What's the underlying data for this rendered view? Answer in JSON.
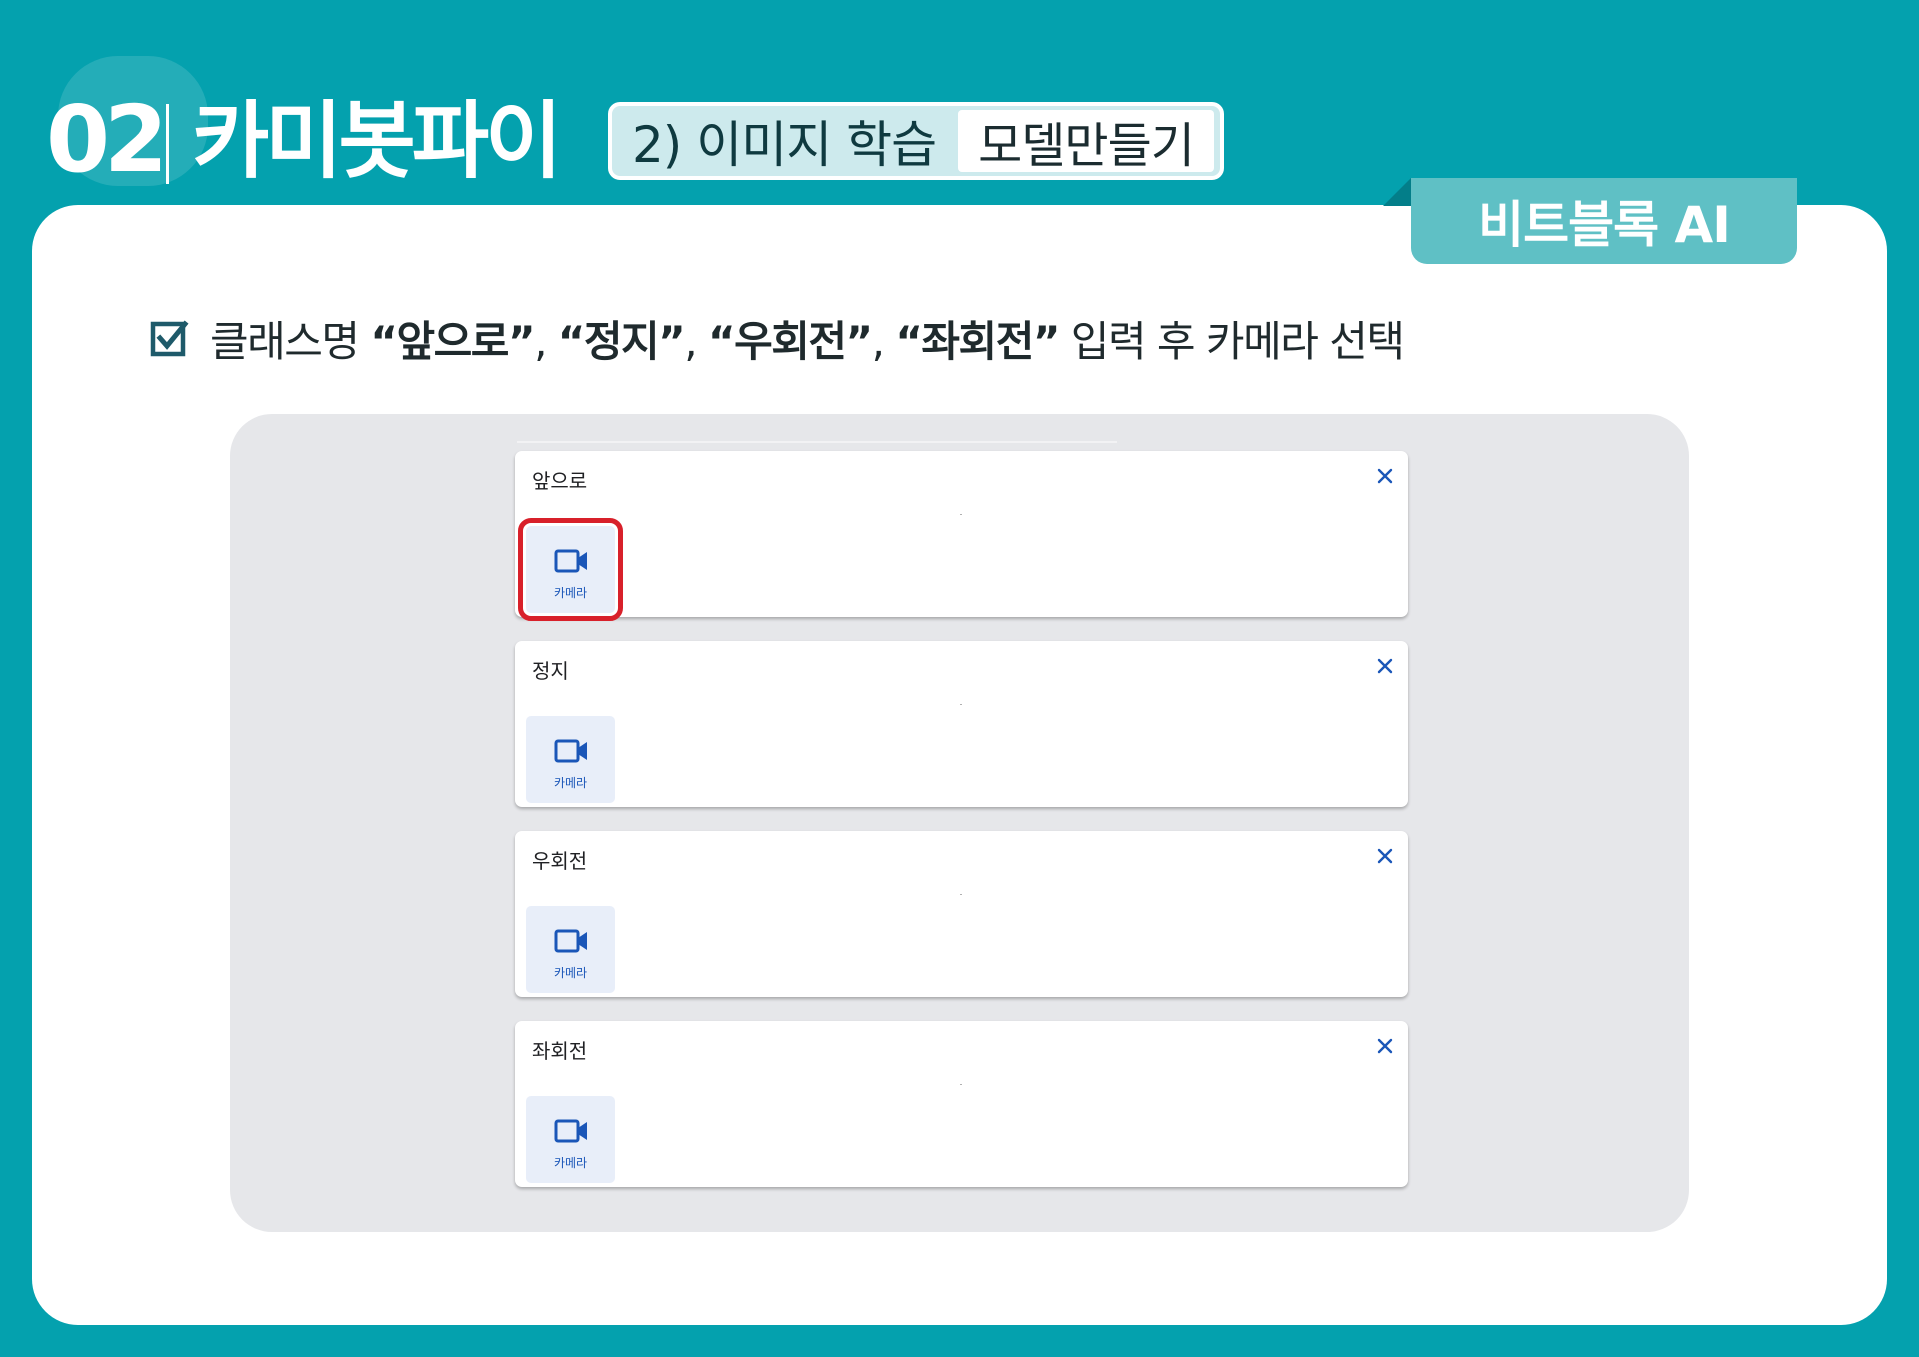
{
  "header": {
    "chapter_number": "02",
    "chapter_title": "카미봇파이",
    "subtitle": "2) 이미지 학습",
    "subtitle_tag": "모델만들기",
    "brand": "비트블록 AI"
  },
  "instruction": {
    "t1": "클래스명 ",
    "q1": "“앞으로”",
    "s1": ", ",
    "q2": "“정지”",
    "s2": ", ",
    "q3": "“우회전”",
    "s3": ", ",
    "q4": "“좌회전”",
    "t2": " 입력 후  카메라 선택"
  },
  "classes": [
    {
      "name": "앞으로",
      "camera_label": "카메라"
    },
    {
      "name": "정지",
      "camera_label": "카메라"
    },
    {
      "name": "우회전",
      "camera_label": "카메라"
    },
    {
      "name": "좌회전",
      "camera_label": "카메라"
    }
  ],
  "colors": {
    "background": "#04a1ae",
    "highlight": "#d8202a",
    "icon_blue": "#1a56b8",
    "check_icon": "#1e5a6a"
  },
  "icons": [
    "checkbox-checked-icon",
    "close-icon",
    "camera-icon"
  ]
}
